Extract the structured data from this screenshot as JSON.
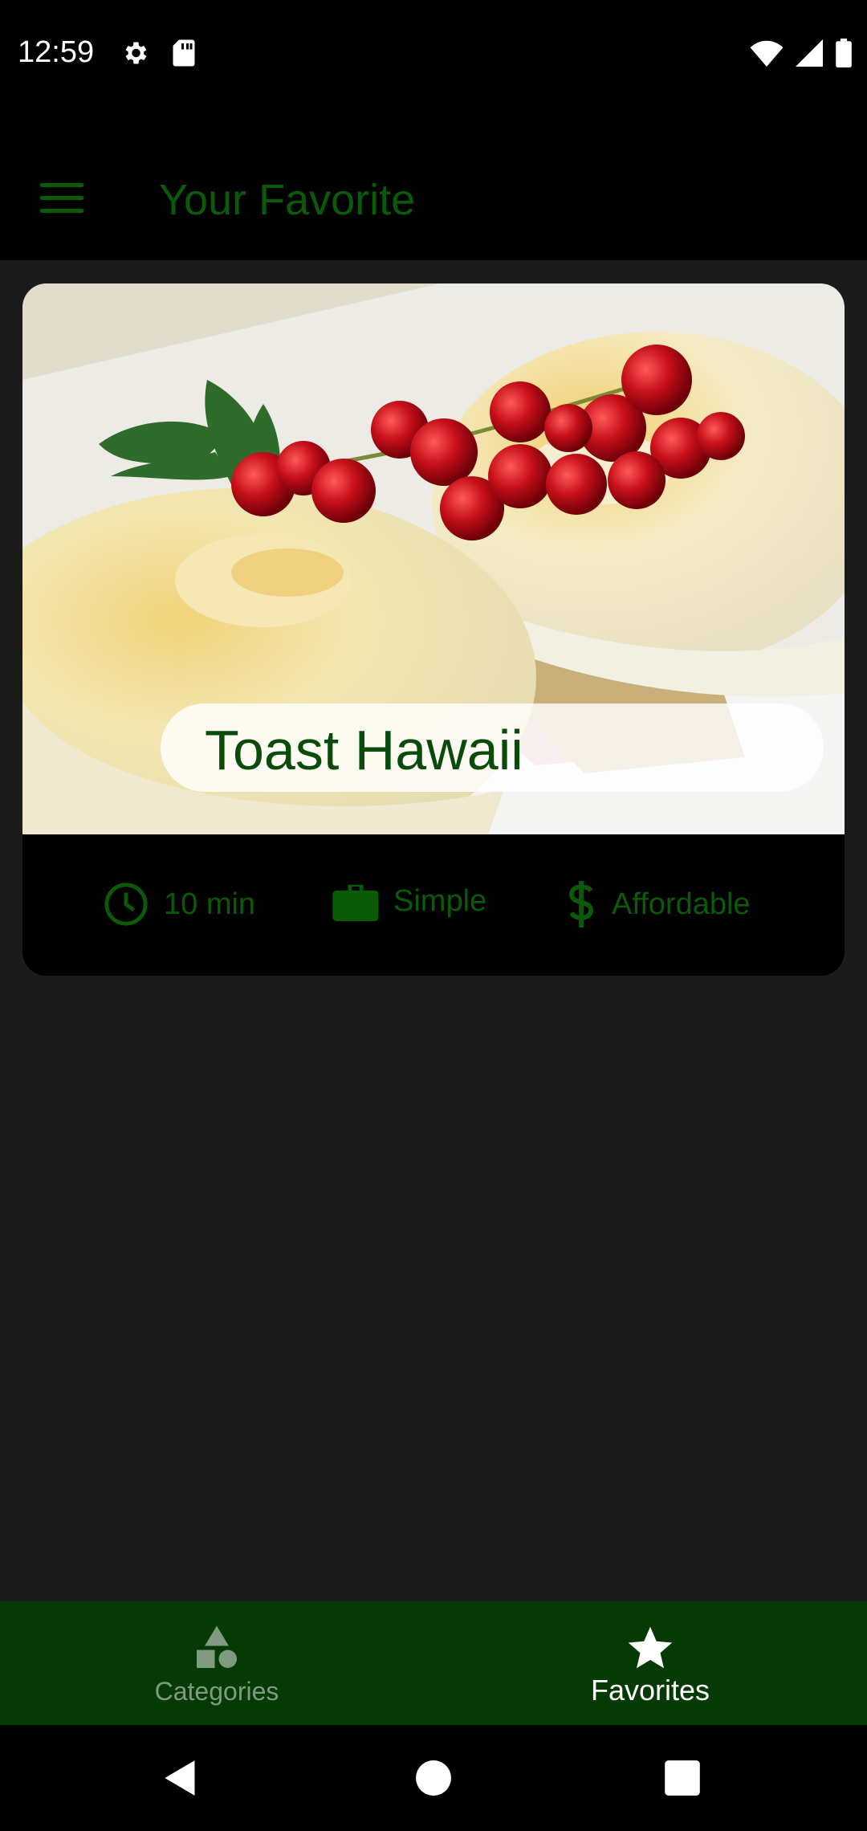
{
  "status_bar": {
    "time": "12:59",
    "icons_left": [
      "settings-icon",
      "sd-card-icon"
    ],
    "icons_right": [
      "wifi-icon",
      "signal-icon",
      "battery-icon"
    ]
  },
  "app_bar": {
    "menu_icon": "menu-icon",
    "title": "Your Favorite"
  },
  "card": {
    "image_alt": "Toast Hawaii photo",
    "title": "Toast Hawaii",
    "duration": "10 min",
    "complexity": "Simple",
    "affordability": "Affordable"
  },
  "bottom_nav": {
    "items": [
      {
        "label": "Categories",
        "icon": "categories-icon",
        "active": false
      },
      {
        "label": "Favorites",
        "icon": "star-icon",
        "active": true
      }
    ]
  },
  "system_nav": [
    "back-icon",
    "home-icon",
    "recents-icon"
  ],
  "colors": {
    "accent": "#0a5a0a",
    "nav_bg": "#053a05",
    "background": "#1b1b1b"
  }
}
